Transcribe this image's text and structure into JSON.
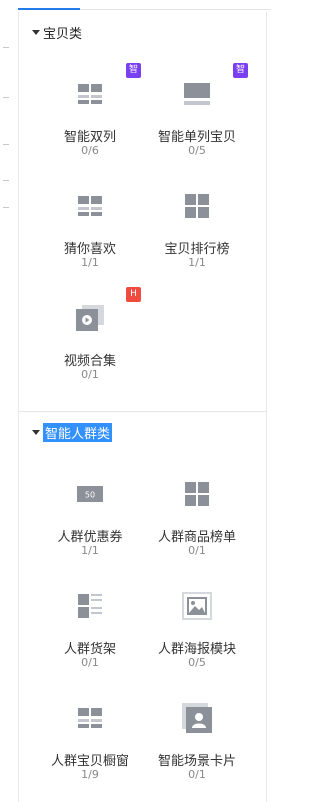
{
  "colors": {
    "accent": "#1f7ce8",
    "icon": "#8b9099",
    "badge_zhi": "#7b3ff2",
    "badge_hot": "#ef4b3f",
    "selection": "#3390ff"
  },
  "sections": [
    {
      "title": "宝贝类",
      "items": [
        {
          "name": "智能双列",
          "count": "0/6",
          "icon": "two-column-icon",
          "badge": "智"
        },
        {
          "name": "智能单列宝贝",
          "count": "0/5",
          "icon": "single-column-icon",
          "badge": "智"
        },
        {
          "name": "猜你喜欢",
          "count": "1/1",
          "icon": "two-column-icon",
          "badge": ""
        },
        {
          "name": "宝贝排行榜",
          "count": "1/1",
          "icon": "grid-icon",
          "badge": ""
        },
        {
          "name": "视频合集",
          "count": "0/1",
          "icon": "video-icon",
          "badge": "H"
        }
      ]
    },
    {
      "title": "智能人群类",
      "items": [
        {
          "name": "人群优惠券",
          "count": "1/1",
          "icon": "coupon-icon",
          "coupon_text": "50"
        },
        {
          "name": "人群商品榜单",
          "count": "0/1",
          "icon": "grid-icon"
        },
        {
          "name": "人群货架",
          "count": "0/1",
          "icon": "shelf-icon"
        },
        {
          "name": "人群海报模块",
          "count": "0/5",
          "icon": "poster-icon"
        },
        {
          "name": "人群宝贝橱窗",
          "count": "1/9",
          "icon": "two-column-icon"
        },
        {
          "name": "智能场景卡片",
          "count": "0/1",
          "icon": "scene-card-icon"
        }
      ]
    }
  ]
}
